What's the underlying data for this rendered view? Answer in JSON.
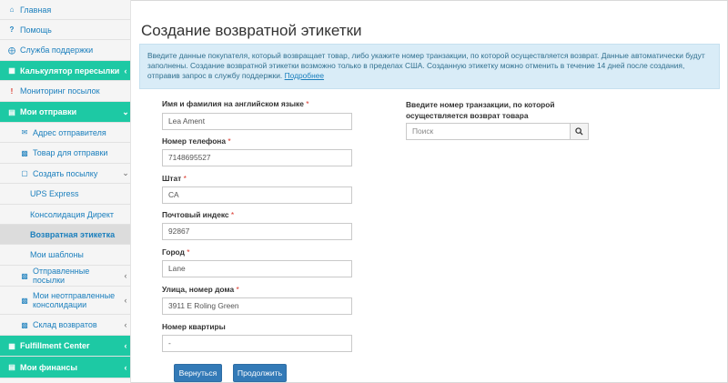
{
  "sidebar": {
    "home": "Главная",
    "help": "Помощь",
    "support": "Служба поддержки",
    "calc": "Калькулятор пересылки",
    "monitoring": "Мониторинг посылок",
    "my_shipments": "Мои отправки",
    "sender_address": "Адрес отправителя",
    "goods": "Товар для отправки",
    "create_parcel": "Создать посылку",
    "ups_express": "UPS Express",
    "consolidation": "Консолидация Директ",
    "return_label": "Возвратная этикетка",
    "templates": "Мои шаблоны",
    "sent_parcels": "Отправленные посылки",
    "unsent_consolidations": "Мои неотправленные консолидации",
    "returns_warehouse": "Склад возвратов",
    "fulfillment": "Fulfillment Center",
    "finances": "Мои финансы"
  },
  "page": {
    "title": "Создание возвратной этикетки",
    "info_text": "Введите данные покупателя, который возвращает товар, либо укажите номер транзакции, по которой осуществляется возврат. Данные автоматически будут заполнены. Создание возвратной этикетки возможно только в пределах США. Созданную этикетку можно отменить в течение 14 дней после создания, отправив запрос в службу поддержки.",
    "info_more": "Подробнее"
  },
  "form": {
    "name_label": "Имя и фамилия на английском языке",
    "name_value": "Lea Ament",
    "phone_label": "Номер телефона",
    "phone_value": "7148695527",
    "state_label": "Штат",
    "state_value": "CA",
    "zip_label": "Почтовый индекс",
    "zip_value": "92867",
    "city_label": "Город",
    "city_value": "Lane",
    "street_label": "Улица, номер дома",
    "street_value": "3911 E Roling Green",
    "apt_label": "Номер квартиры",
    "apt_value": "-",
    "required_mark": "*"
  },
  "transaction": {
    "label": "Введите номер транзакции, по которой осуществляется возврат товара",
    "placeholder": "Поиск"
  },
  "buttons": {
    "back": "Вернуться",
    "continue": "Продолжить"
  },
  "colors": {
    "sidebar_green": "#1dc9a4",
    "link_blue": "#1b7fbd",
    "button_blue": "#337ab7",
    "info_bg": "#d9ecf7"
  }
}
